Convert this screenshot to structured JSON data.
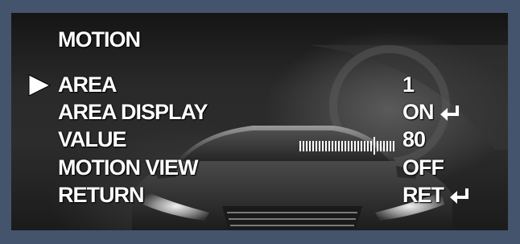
{
  "menu": {
    "title": "MOTION",
    "items": [
      {
        "label": "AREA",
        "value": "1",
        "selected": true,
        "enter_icon": false
      },
      {
        "label": "AREA DISPLAY",
        "value": "ON",
        "selected": false,
        "enter_icon": true
      },
      {
        "label": "VALUE",
        "value": "80",
        "selected": false,
        "enter_icon": false,
        "slider_level": 0.8
      },
      {
        "label": "MOTION VIEW",
        "value": "OFF",
        "selected": false,
        "enter_icon": false
      },
      {
        "label": "RETURN",
        "value": "RET",
        "selected": false,
        "enter_icon": true
      }
    ]
  },
  "colors": {
    "frame": "#45546d",
    "text": "#ffffff"
  },
  "icons": {
    "cursor": "play-triangle-icon",
    "enter": "enter-arrow-icon"
  }
}
